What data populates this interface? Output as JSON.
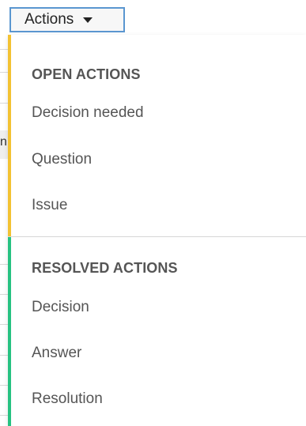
{
  "actions_button": {
    "label": "Actions",
    "caret_icon": "caret-down-icon"
  },
  "background": {
    "partial_text": "n"
  },
  "menu": {
    "sections": [
      {
        "header": "OPEN ACTIONS",
        "accent_color": "#f3c232",
        "items": [
          {
            "label": "Decision needed"
          },
          {
            "label": "Question"
          },
          {
            "label": "Issue"
          }
        ]
      },
      {
        "header": "RESOLVED ACTIONS",
        "accent_color": "#26c281",
        "items": [
          {
            "label": "Decision"
          },
          {
            "label": "Answer"
          },
          {
            "label": "Resolution"
          }
        ]
      }
    ]
  },
  "colors": {
    "button_border": "#5a96d0",
    "text": "#555555"
  }
}
